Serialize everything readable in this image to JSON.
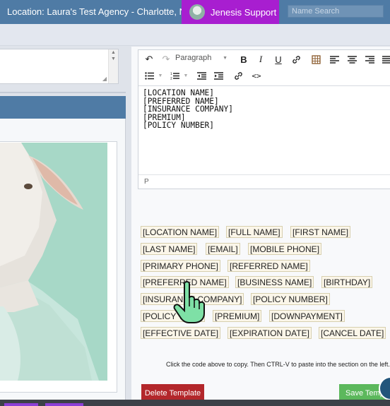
{
  "header": {
    "location": "Location: Laura's Test Agency - Charlotte, NC",
    "support_label": "Jenesis Support",
    "search_placeholder": "Name Search"
  },
  "editor": {
    "format_select": "Paragraph",
    "content_lines": [
      "[LOCATION NAME]",
      "[PREFERRED NAME]",
      "[INSURANCE COMPANY]",
      "[PREMIUM]",
      "[POLICY NUMBER]"
    ],
    "status_path": "P"
  },
  "merge_tags": [
    "[LOCATION NAME]",
    "[FULL NAME]",
    "[FIRST NAME]",
    "[LAST NAME]",
    "[EMAIL]",
    "[MOBILE PHONE]",
    "[PRIMARY PHONE]",
    "[REFERRED NAME]",
    "[PREFERRED NAME]",
    "[BUSINESS NAME]",
    "[BIRTHDAY]",
    "[INSURANCE COMPANY]",
    "[POLICY NUMBER]",
    "[POLICY TYPE]",
    "[PREMIUM]",
    "[DOWNPAYMENT]",
    "[EFFECTIVE DATE]",
    "[EXPIRATION DATE]",
    "[CANCEL DATE]"
  ],
  "hint": "Click the code above to copy. Then CTRL-V to paste into the section on the left.",
  "buttons": {
    "delete": "Delete Template",
    "save": "Save Template"
  },
  "colors": {
    "header_bg": "#4f7ba5",
    "support_bg": "#a81ed0",
    "delete_bg": "#b3272b",
    "save_bg": "#5cb85c",
    "tag_bg": "#fbf6e9"
  }
}
